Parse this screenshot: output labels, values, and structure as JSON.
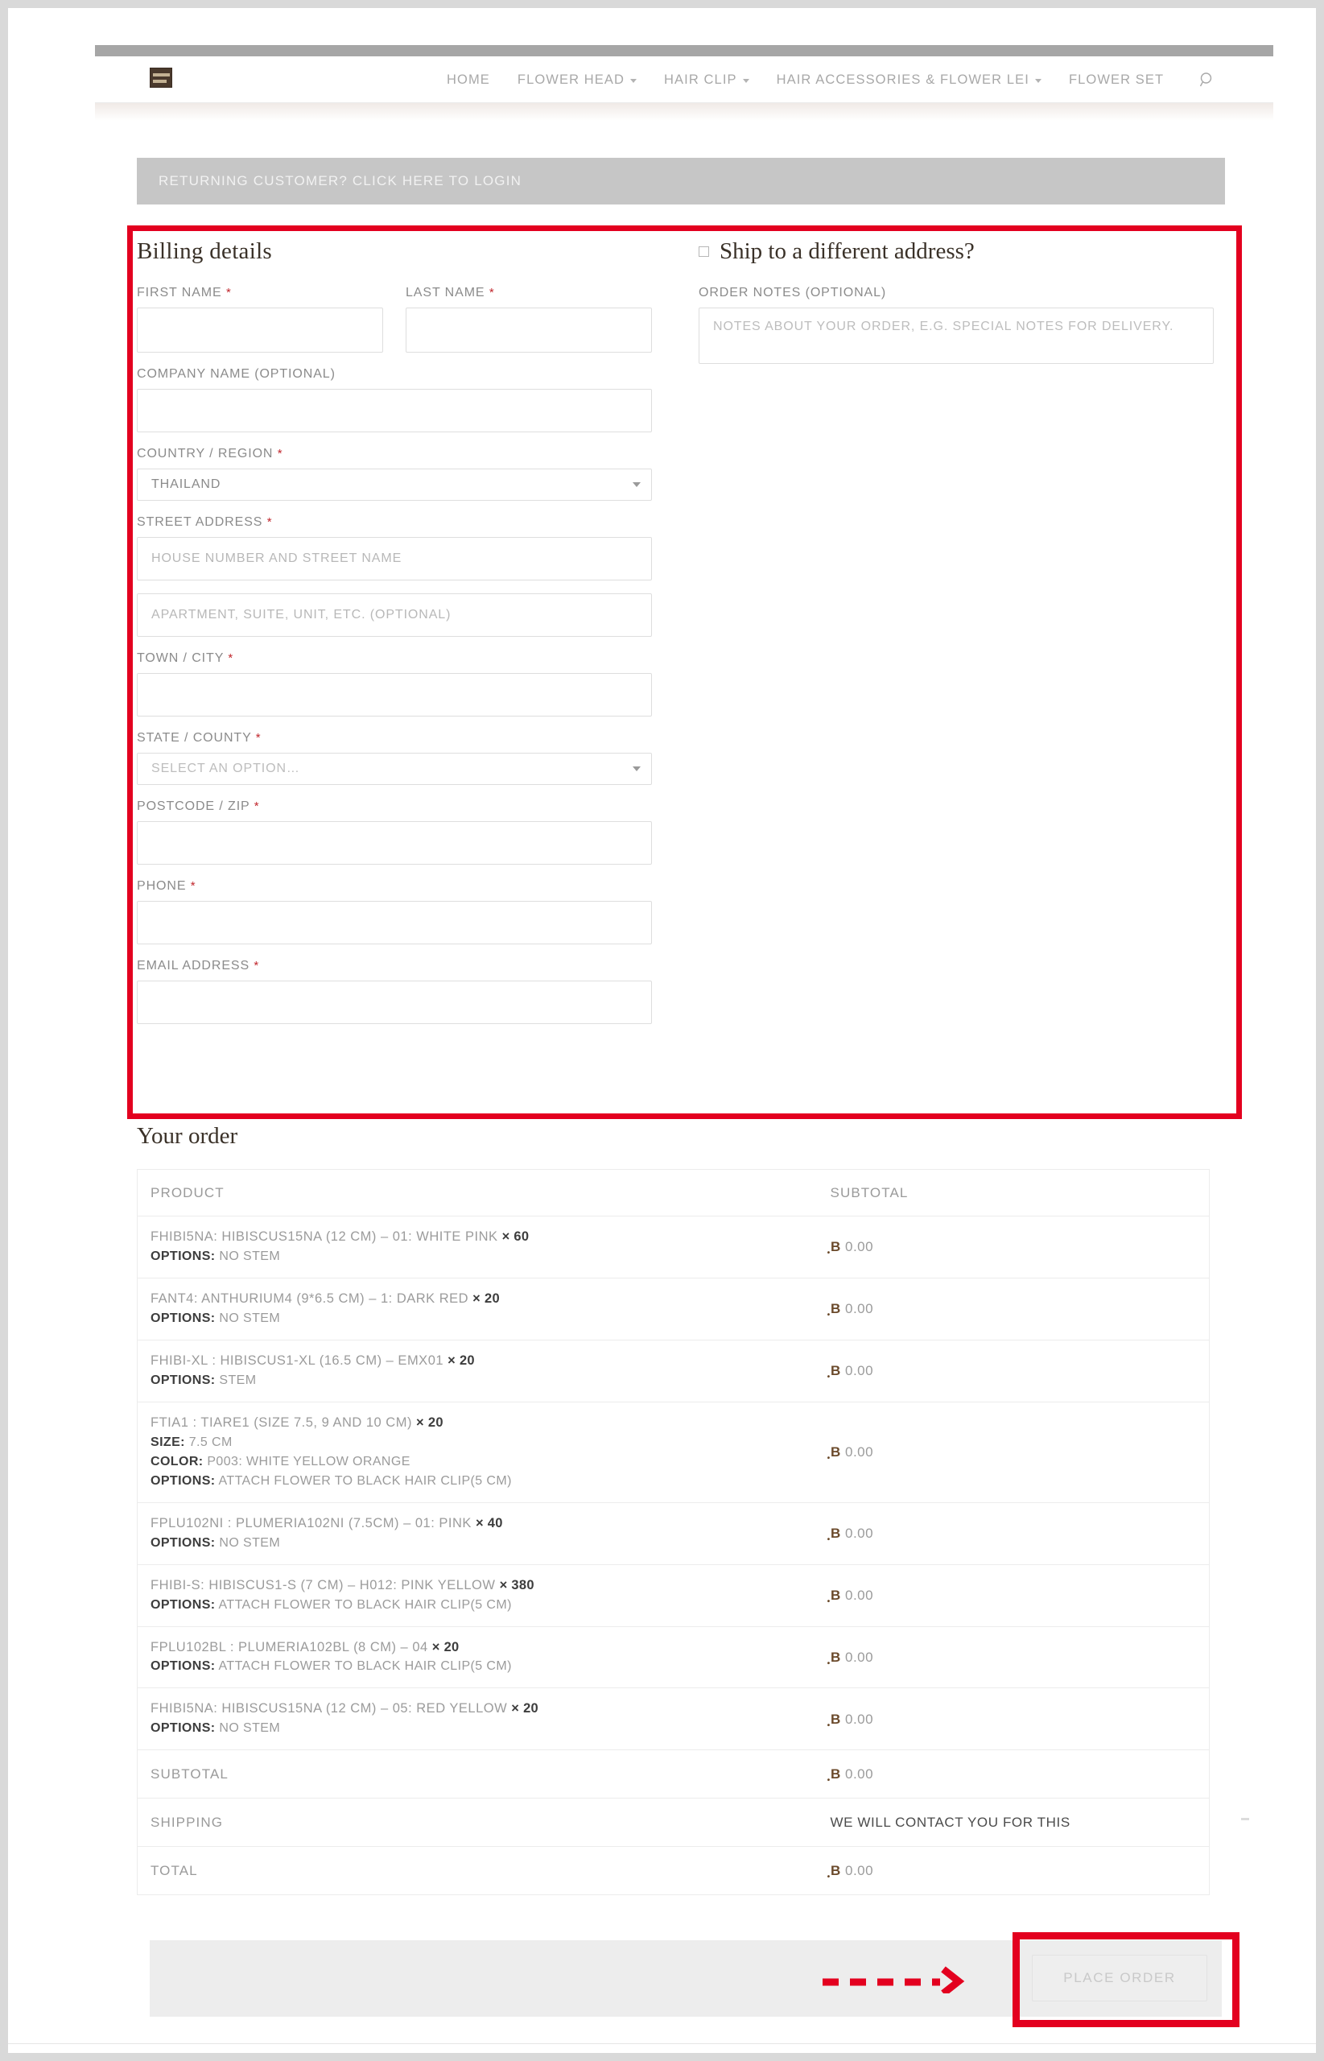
{
  "header": {
    "logo_alt": "site-logo",
    "nav": [
      {
        "label": "HOME",
        "has_caret": false
      },
      {
        "label": "FLOWER HEAD",
        "has_caret": true
      },
      {
        "label": "HAIR CLIP",
        "has_caret": true
      },
      {
        "label": "HAIR ACCESSORIES & FLOWER LEI",
        "has_caret": true
      },
      {
        "label": "FLOWER SET",
        "has_caret": false
      }
    ],
    "search_icon": "search-icon"
  },
  "login_banner": {
    "text": "RETURNING CUSTOMER? CLICK HERE TO LOGIN"
  },
  "billing": {
    "title": "Billing details",
    "first_name": {
      "label": "FIRST NAME",
      "required": "*",
      "value": ""
    },
    "last_name": {
      "label": "LAST NAME",
      "required": "*",
      "value": ""
    },
    "company": {
      "label": "COMPANY NAME (OPTIONAL)",
      "value": ""
    },
    "country": {
      "label": "COUNTRY / REGION",
      "required": "*",
      "value": "THAILAND"
    },
    "street": {
      "label": "STREET ADDRESS",
      "required": "*",
      "placeholder_1": "HOUSE NUMBER AND STREET NAME",
      "placeholder_2": "APARTMENT, SUITE, UNIT, ETC. (OPTIONAL)",
      "value_1": "",
      "value_2": ""
    },
    "city": {
      "label": "TOWN / CITY",
      "required": "*",
      "value": ""
    },
    "state": {
      "label": "STATE / COUNTY",
      "required": "*",
      "value": "SELECT AN OPTION…"
    },
    "postcode": {
      "label": "POSTCODE / ZIP",
      "required": "*",
      "value": ""
    },
    "phone": {
      "label": "PHONE",
      "required": "*",
      "value": ""
    },
    "email": {
      "label": "EMAIL ADDRESS",
      "required": "*",
      "value": ""
    }
  },
  "shipping": {
    "title": "Ship to a different address?",
    "checkbox_checked": false,
    "notes": {
      "label": "ORDER NOTES (OPTIONAL)",
      "placeholder": "NOTES ABOUT YOUR ORDER, E.G. SPECIAL NOTES FOR DELIVERY.",
      "value": ""
    }
  },
  "order": {
    "title": "Your order",
    "columns": [
      "PRODUCT",
      "SUBTOTAL"
    ],
    "items": [
      {
        "name": "FHIBI5NA: HIBISCUS15NA (12 CM) – 01: WHITE PINK",
        "qty": "× 60",
        "meta": [
          {
            "key": "OPTIONS",
            "value": "NO STEM"
          }
        ],
        "subtotal_currency": "ฺB",
        "subtotal": "0.00"
      },
      {
        "name": "FANT4: ANTHURIUM4 (9*6.5 CM) – 1: DARK RED",
        "qty": "× 20",
        "meta": [
          {
            "key": "OPTIONS",
            "value": "NO STEM"
          }
        ],
        "subtotal_currency": "ฺB",
        "subtotal": "0.00"
      },
      {
        "name": "FHIBI-XL : HIBISCUS1-XL (16.5 CM) – EMX01",
        "qty": "× 20",
        "meta": [
          {
            "key": "OPTIONS",
            "value": "STEM"
          }
        ],
        "subtotal_currency": "ฺB",
        "subtotal": "0.00"
      },
      {
        "name": "FTIA1 : TIARE1 (SIZE 7.5, 9 AND 10 CM)",
        "qty": "× 20",
        "meta": [
          {
            "key": "SIZE",
            "value": "7.5 CM"
          },
          {
            "key": "COLOR",
            "value": "P003: WHITE YELLOW ORANGE"
          },
          {
            "key": "OPTIONS",
            "value": "ATTACH FLOWER TO BLACK HAIR CLIP(5 CM)"
          }
        ],
        "subtotal_currency": "ฺB",
        "subtotal": "0.00"
      },
      {
        "name": "FPLU102NI : PLUMERIA102NI (7.5CM) – 01: PINK",
        "qty": "× 40",
        "meta": [
          {
            "key": "OPTIONS",
            "value": "NO STEM"
          }
        ],
        "subtotal_currency": "ฺB",
        "subtotal": "0.00"
      },
      {
        "name": "FHIBI-S: HIBISCUS1-S (7 CM) – H012: PINK YELLOW",
        "qty": "× 380",
        "meta": [
          {
            "key": "OPTIONS",
            "value": "ATTACH FLOWER TO BLACK HAIR CLIP(5 CM)"
          }
        ],
        "subtotal_currency": "ฺB",
        "subtotal": "0.00"
      },
      {
        "name": "FPLU102BL : PLUMERIA102BL (8 CM) – 04",
        "qty": "× 20",
        "meta": [
          {
            "key": "OPTIONS",
            "value": "ATTACH FLOWER TO BLACK HAIR CLIP(5 CM)"
          }
        ],
        "subtotal_currency": "ฺB",
        "subtotal": "0.00"
      },
      {
        "name": "FHIBI5NA: HIBISCUS15NA (12 CM) – 05: RED YELLOW",
        "qty": "× 20",
        "meta": [
          {
            "key": "OPTIONS",
            "value": "NO STEM"
          }
        ],
        "subtotal_currency": "ฺB",
        "subtotal": "0.00"
      }
    ],
    "totals": [
      {
        "label": "SUBTOTAL",
        "currency": "ฺB",
        "value": "0.00",
        "is_text": false
      },
      {
        "label": "SHIPPING",
        "currency": "",
        "value": "WE WILL CONTACT YOU FOR THIS",
        "is_text": true
      },
      {
        "label": "TOTAL",
        "currency": "ฺB",
        "value": "0.00",
        "is_text": false
      }
    ]
  },
  "footer": {
    "place_order_label": "PLACE ORDER"
  },
  "annotations": {
    "accent_color": "#e3001f",
    "arrow": "dashed-arrow-right",
    "highlight_form": "billing-form-highlight",
    "highlight_button": "place-order-highlight"
  }
}
